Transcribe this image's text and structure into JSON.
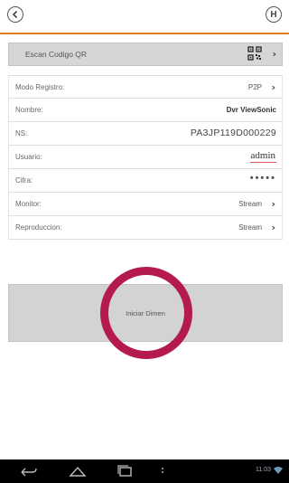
{
  "toolbar": {
    "back_icon": "back-arrow-icon",
    "save_label": "H"
  },
  "scan": {
    "label": "Escan Codigo QR",
    "icon": "qr-code-icon"
  },
  "form": {
    "rows": [
      {
        "label": "Modo Registro:",
        "value": "P2P"
      },
      {
        "label": "Nombre:",
        "value": "Dvr ViewSonic"
      },
      {
        "label": "NS:",
        "value": "PA3JP119D000229"
      },
      {
        "label": "Usuario:",
        "value": "admin"
      },
      {
        "label": "Cifra:",
        "value": "•••••"
      },
      {
        "label": "Monitor:",
        "value": "Stream"
      },
      {
        "label": "Reproduccion:",
        "value": "Stream"
      }
    ]
  },
  "start": {
    "label": "Iniciar Dimen"
  },
  "status_bar": {
    "time": "11:03"
  },
  "colors": {
    "accent": "#e07b22",
    "highlight_circle": "#b51a4e"
  }
}
